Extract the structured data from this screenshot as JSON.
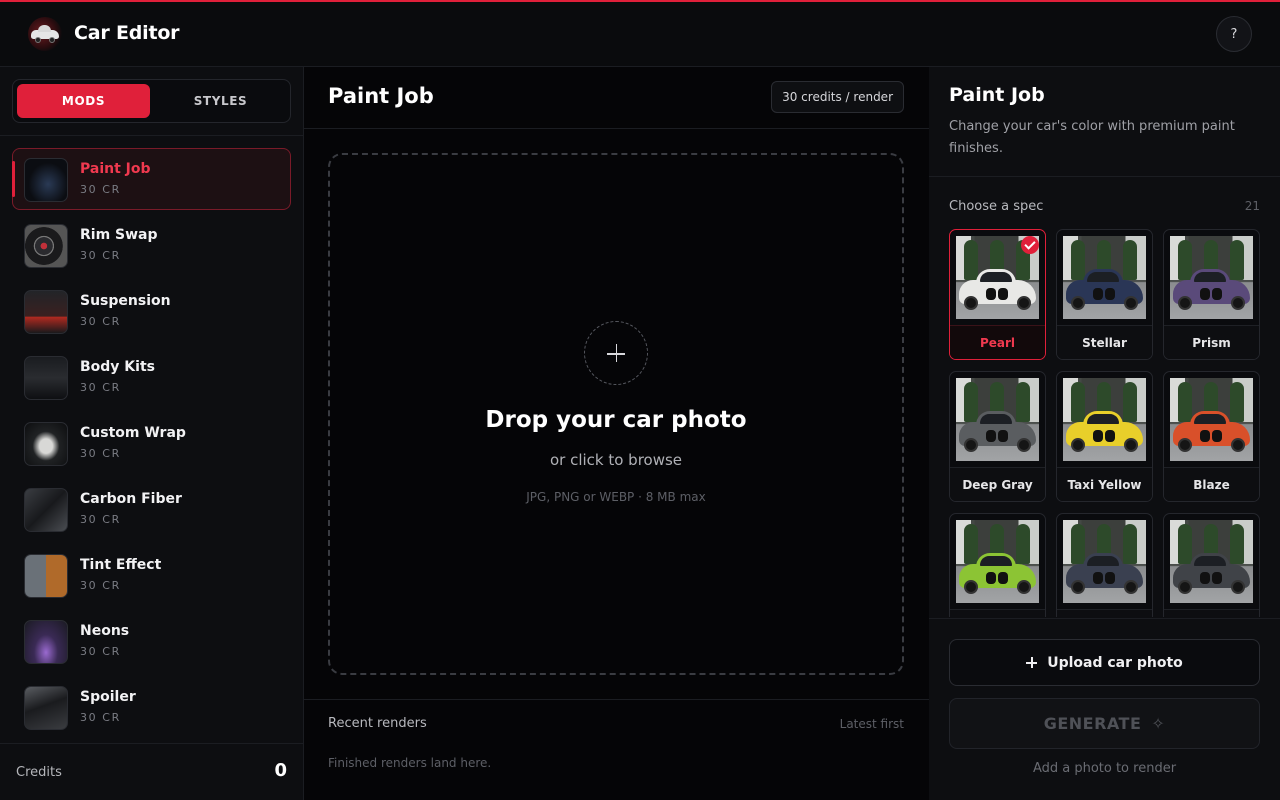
{
  "app": {
    "title": "Car Editor",
    "help_label": "?"
  },
  "sidebar": {
    "tabs": [
      {
        "label": "MODS",
        "active": true
      },
      {
        "label": "STYLES",
        "active": false
      }
    ],
    "mods": [
      {
        "name": "Paint Job",
        "cost": "30 CR",
        "active": true,
        "thumb": "paint"
      },
      {
        "name": "Rim Swap",
        "cost": "30 CR",
        "active": false,
        "thumb": "rim"
      },
      {
        "name": "Suspension",
        "cost": "30 CR",
        "active": false,
        "thumb": "suspension"
      },
      {
        "name": "Body Kits",
        "cost": "30 CR",
        "active": false,
        "thumb": "bodykit"
      },
      {
        "name": "Custom Wrap",
        "cost": "30 CR",
        "active": false,
        "thumb": "wrap"
      },
      {
        "name": "Carbon Fiber",
        "cost": "30 CR",
        "active": false,
        "thumb": "carbon"
      },
      {
        "name": "Tint Effect",
        "cost": "30 CR",
        "active": false,
        "thumb": "tint"
      },
      {
        "name": "Neons",
        "cost": "30 CR",
        "active": false,
        "thumb": "neon"
      },
      {
        "name": "Spoiler",
        "cost": "30 CR",
        "active": false,
        "thumb": "spoiler"
      }
    ],
    "credits_label": "Credits",
    "credits_value": "0"
  },
  "center": {
    "title": "Paint Job",
    "credit_pill": "30 credits / render",
    "drop_title": "Drop your car photo",
    "drop_sub": "or click to browse",
    "drop_hint": "JPG, PNG or WEBP · 8 MB max",
    "recent_title": "Recent renders",
    "recent_sort": "Latest first",
    "recent_empty": "Finished renders land here."
  },
  "panel": {
    "title": "Paint Job",
    "description": "Change your car's color with premium paint finishes.",
    "spec_label": "Choose a spec",
    "spec_count": "21",
    "specs": [
      {
        "label": "Pearl",
        "color": "#e8e8e6",
        "selected": true
      },
      {
        "label": "Stellar",
        "color": "#2a3656",
        "selected": false
      },
      {
        "label": "Prism",
        "color": "#5a4a7a",
        "selected": false
      },
      {
        "label": "Deep Gray",
        "color": "#5a5d60",
        "selected": false
      },
      {
        "label": "Taxi Yellow",
        "color": "#e8cf2a",
        "selected": false
      },
      {
        "label": "Blaze",
        "color": "#d9502a",
        "selected": false
      },
      {
        "label": "",
        "color": "#8cc434",
        "selected": false
      },
      {
        "label": "",
        "color": "#3a4050",
        "selected": false
      },
      {
        "label": "",
        "color": "#404348",
        "selected": false
      }
    ],
    "upload_label": "Upload car photo",
    "generate_label": "GENERATE",
    "generate_hint": "Add a photo to render"
  }
}
